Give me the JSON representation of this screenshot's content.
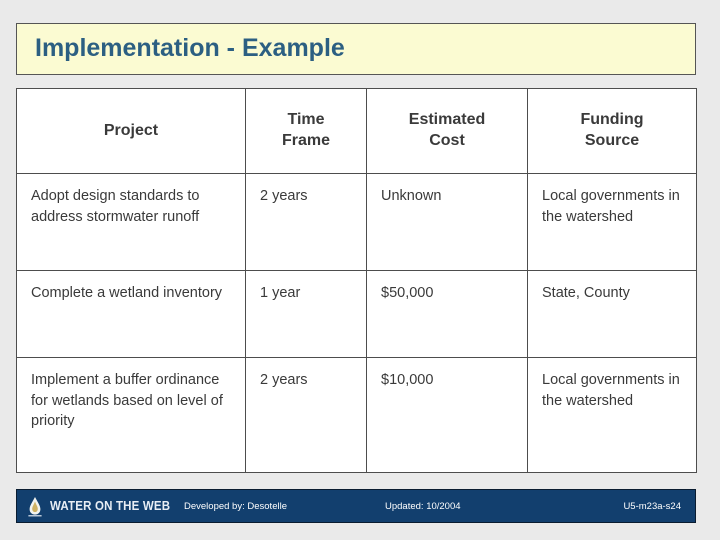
{
  "slide": {
    "title": "Implementation - Example"
  },
  "table": {
    "columns": [
      "Project",
      "Time\nFrame",
      "Estimated\nCost",
      "Funding\nSource"
    ],
    "columns_display": [
      {
        "line1": "Project",
        "line2": ""
      },
      {
        "line1": "Time",
        "line2": "Frame"
      },
      {
        "line1": "Estimated",
        "line2": "Cost"
      },
      {
        "line1": "Funding",
        "line2": "Source"
      }
    ],
    "rows": [
      {
        "project": "Adopt design standards to address stormwater runoff",
        "time_frame": "2 years",
        "estimated_cost": "Unknown",
        "funding_source": "Local governments in the watershed"
      },
      {
        "project": "Complete a wetland inventory",
        "time_frame": "1 year",
        "estimated_cost": "$50,000",
        "funding_source": "State, County"
      },
      {
        "project": "Implement a buffer ordinance for wetlands based on level of priority",
        "time_frame": "2 years",
        "estimated_cost": "$10,000",
        "funding_source": "Local governments in the watershed"
      }
    ]
  },
  "footer": {
    "brand": "WATER ON THE WEB",
    "developed_by": "Developed by:  Desotelle",
    "updated": "Updated: 10/2004",
    "code": "U5-m23a-s24",
    "logo_icon": "water-droplet-icon"
  },
  "colors": {
    "title_background": "#fbfbd2",
    "title_text": "#2c5f82",
    "slide_background": "#eaeaea",
    "footer_background": "#123f6e",
    "table_border": "#4d4d4d",
    "table_text": "#3a3a3a"
  }
}
